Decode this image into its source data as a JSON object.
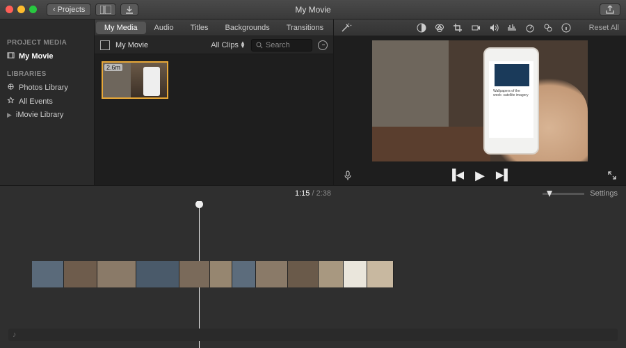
{
  "window": {
    "title": "My Movie",
    "back_label": "Projects"
  },
  "colors": {
    "close": "#ff5f57",
    "min": "#febc2e",
    "max": "#28c840",
    "selection": "#e8a838"
  },
  "sidebar": {
    "project_media_header": "PROJECT MEDIA",
    "project_item": "My Movie",
    "libraries_header": "LIBRARIES",
    "items": [
      {
        "label": "Photos Library",
        "icon": "photos-icon"
      },
      {
        "label": "All Events",
        "icon": "star-icon"
      },
      {
        "label": "iMovie Library",
        "icon": "disclosure-icon"
      }
    ]
  },
  "tabs": [
    {
      "label": "My Media",
      "active": true
    },
    {
      "label": "Audio",
      "active": false
    },
    {
      "label": "Titles",
      "active": false
    },
    {
      "label": "Backgrounds",
      "active": false
    },
    {
      "label": "Transitions",
      "active": false
    }
  ],
  "browser": {
    "event_name": "My Movie",
    "clips_filter": "All Clips",
    "search_placeholder": "Search",
    "clip_duration": "2.6m"
  },
  "viewer": {
    "reset_label": "Reset All",
    "preview_text_title": "Wallpapers of the week: satellite imagery"
  },
  "timeline": {
    "current_time": "1:15",
    "total_time": "2:38",
    "settings_label": "Settings",
    "clip_widths": [
      46,
      48,
      56,
      62,
      44,
      32,
      34,
      46,
      44,
      36,
      34,
      38
    ]
  }
}
